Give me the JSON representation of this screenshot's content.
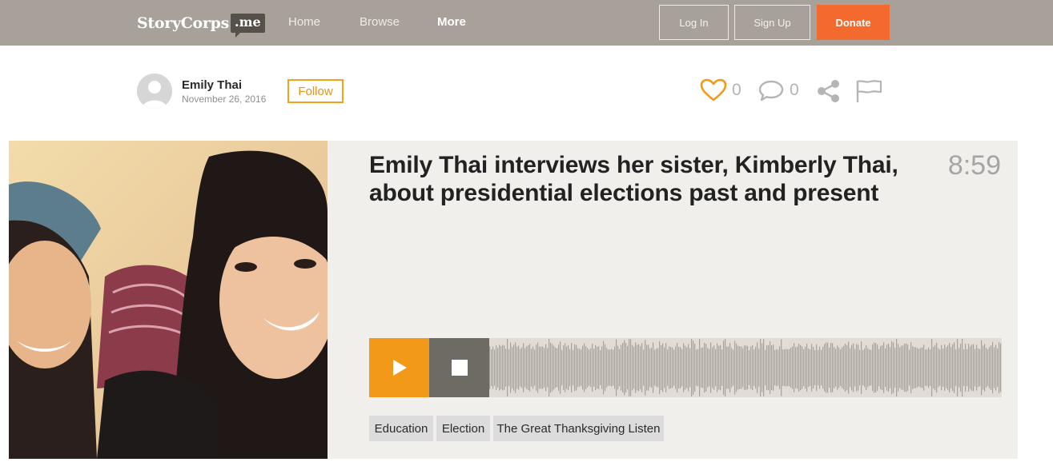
{
  "header": {
    "logo_text": "StoryCorps",
    "logo_suffix": ".me",
    "nav": [
      {
        "label": "Home",
        "active": false
      },
      {
        "label": "Browse",
        "active": false
      },
      {
        "label": "More",
        "active": true
      }
    ],
    "login_label": "Log In",
    "signup_label": "Sign Up",
    "donate_label": "Donate"
  },
  "author": {
    "name": "Emily Thai",
    "date": "November 26, 2016",
    "follow_label": "Follow"
  },
  "actions": {
    "likes": "0",
    "comments": "0"
  },
  "story": {
    "title": "Emily Thai interviews her sister, Kimberly Thai, about presidential elections past and present",
    "duration": "8:59",
    "tags": [
      "Education",
      "Election",
      "The Great Thanksgiving Listen"
    ]
  },
  "colors": {
    "header_bg": "#a8a19a",
    "donate": "#f46a2e",
    "accent": "#f29919",
    "stop": "#6e6a64",
    "panel_bg": "#f0efeb",
    "waveform": "#a6a29c"
  },
  "icons": [
    "heart-icon",
    "comment-icon",
    "share-icon",
    "flag-icon",
    "play-icon",
    "stop-icon"
  ]
}
